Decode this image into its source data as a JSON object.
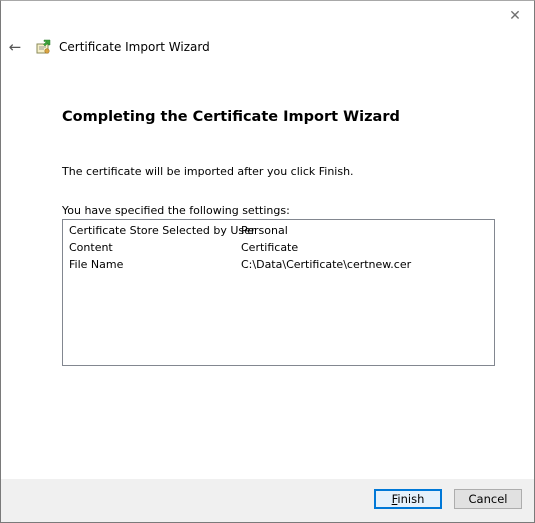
{
  "window": {
    "close_glyph": "✕"
  },
  "header": {
    "back_glyph": "←",
    "title": "Certificate Import Wizard",
    "icon": "certificate-icon"
  },
  "main": {
    "heading": "Completing the Certificate Import Wizard",
    "info_text": "The certificate will be imported after you click Finish.",
    "settings_label": "You have specified the following settings:",
    "settings": [
      {
        "key": "Certificate Store Selected by User",
        "value": "Personal"
      },
      {
        "key": "Content",
        "value": "Certificate"
      },
      {
        "key": "File Name",
        "value": "C:\\Data\\Certificate\\certnew.cer"
      }
    ]
  },
  "footer": {
    "finish_label": "Finish",
    "cancel_label": "Cancel"
  },
  "colors": {
    "accent": "#0078d7",
    "footer_bg": "#f0f0f0",
    "button_bg": "#e1e1e1"
  }
}
